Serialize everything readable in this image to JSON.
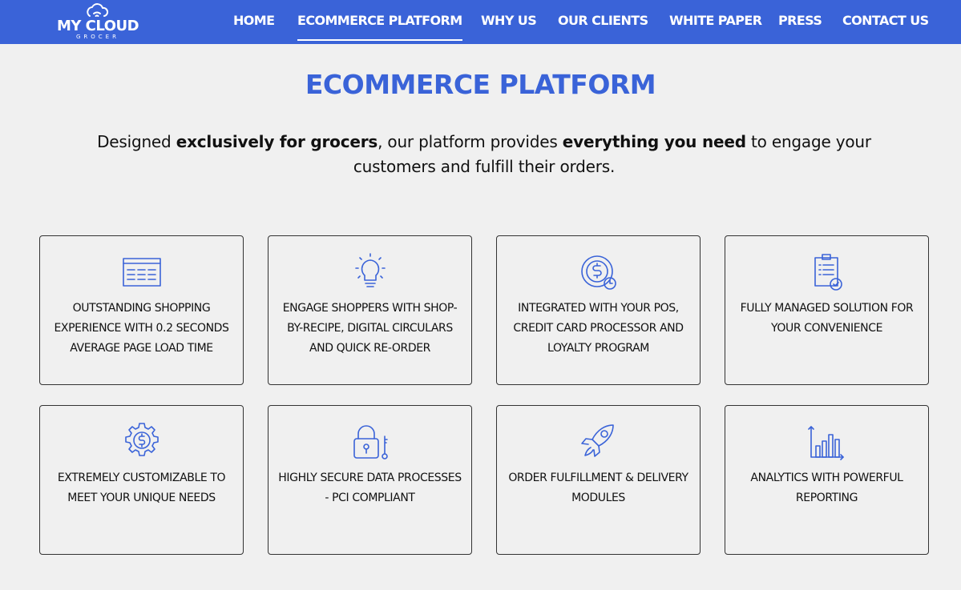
{
  "header": {
    "logo": {
      "title": "MY CLOUD",
      "subtitle": "GROCER"
    },
    "nav": [
      {
        "label": "HOME"
      },
      {
        "label": "ECOMMERCE PLATFORM",
        "active": true
      },
      {
        "label": "WHY US"
      },
      {
        "label": "OUR CLIENTS"
      },
      {
        "label": "WHITE PAPER"
      },
      {
        "label": "PRESS"
      },
      {
        "label": "CONTACT US"
      }
    ]
  },
  "main": {
    "title": "ECOMMERCE PLATFORM",
    "intro": {
      "part1": "Designed ",
      "bold1": "exclusively for grocers",
      "part2": ", our platform provides ",
      "bold2": "everything you need",
      "part3": " to engage your customers and fulfill their orders."
    },
    "features": [
      {
        "icon": "browser-window-icon",
        "text": "OUTSTANDING SHOPPING EXPERIENCE WITH 0.2 SECONDS AVERAGE PAGE LOAD TIME"
      },
      {
        "icon": "lightbulb-icon",
        "text": "ENGAGE SHOPPERS WITH SHOP-BY-RECIPE, DIGITAL CIRCULARS AND QUICK RE-ORDER"
      },
      {
        "icon": "dollar-coin-clock-icon",
        "text": "INTEGRATED WITH YOUR POS, CREDIT CARD PROCESSOR AND LOYALTY PROGRAM"
      },
      {
        "icon": "clipboard-check-icon",
        "text": "FULLY MANAGED SOLUTION FOR YOUR CONVENIENCE"
      },
      {
        "icon": "dollar-gear-icon",
        "text": "EXTREMELY CUSTOMIZABLE TO MEET YOUR UNIQUE NEEDS"
      },
      {
        "icon": "padlock-key-icon",
        "text": "HIGHLY SECURE DATA PROCESSES - PCI COMPLIANT"
      },
      {
        "icon": "rocket-icon",
        "text": "ORDER FULFILLMENT & DELIVERY MODULES"
      },
      {
        "icon": "bar-chart-icon",
        "text": "ANALYTICS WITH POWERFUL REPORTING"
      }
    ]
  },
  "colors": {
    "brand": "#3a63d8",
    "background": "#f0f0f0",
    "text": "#111111"
  }
}
